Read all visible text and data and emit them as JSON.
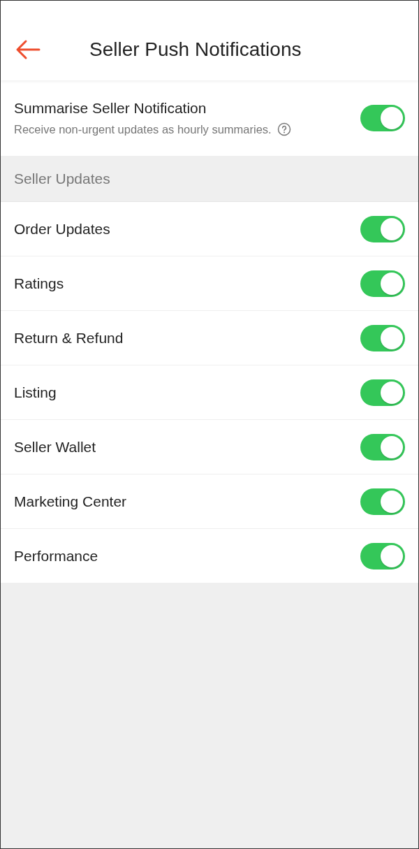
{
  "header": {
    "title": "Seller Push Notifications"
  },
  "summary": {
    "label": "Summarise Seller Notification",
    "description": "Receive non-urgent updates as hourly summaries.",
    "on": true
  },
  "section": {
    "title": "Seller Updates",
    "items": [
      {
        "label": "Order Updates",
        "on": true
      },
      {
        "label": "Ratings",
        "on": true
      },
      {
        "label": "Return & Refund",
        "on": true
      },
      {
        "label": "Listing",
        "on": true
      },
      {
        "label": "Seller Wallet",
        "on": true
      },
      {
        "label": "Marketing Center",
        "on": true
      },
      {
        "label": "Performance",
        "on": true
      }
    ]
  }
}
